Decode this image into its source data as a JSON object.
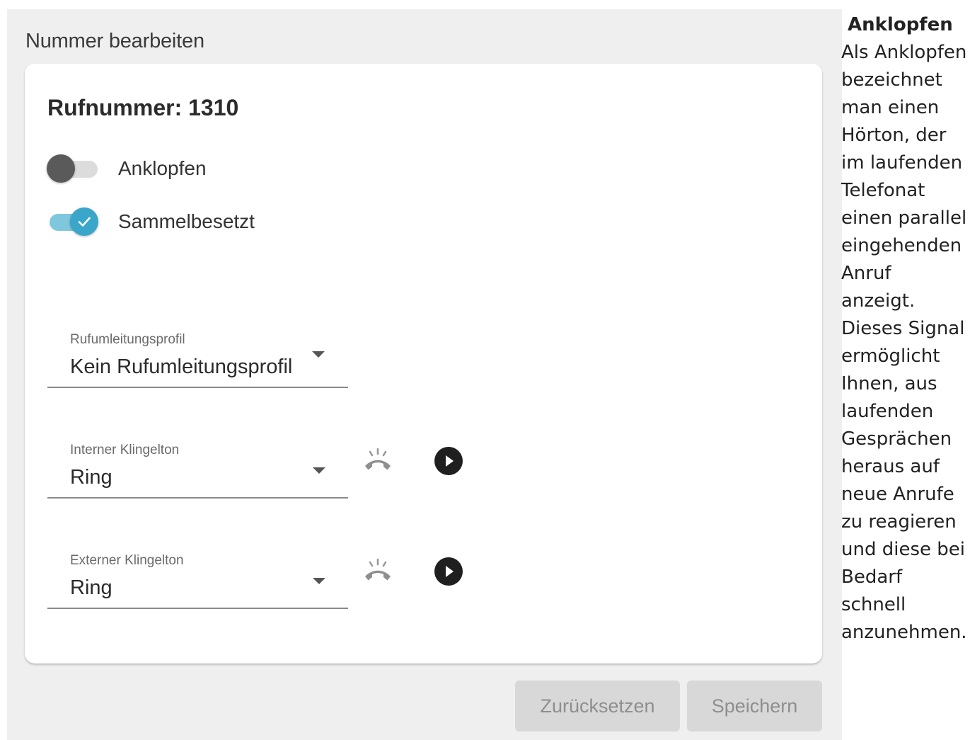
{
  "panel": {
    "title": "Nummer bearbeiten"
  },
  "card": {
    "heading": "Rufnummer: 1310",
    "toggles": [
      {
        "label": "Anklopfen",
        "state": "off"
      },
      {
        "label": "Sammelbesetzt",
        "state": "on"
      }
    ],
    "fields": {
      "redirect": {
        "label": "Rufumleitungsprofil",
        "value": "Kein Rufumleitungsprofil"
      },
      "internal": {
        "label": "Interner Klingelton",
        "value": "Ring"
      },
      "external": {
        "label": "Externer Klingelton",
        "value": "Ring"
      }
    }
  },
  "actions": {
    "reset_label": "Zurücksetzen",
    "save_label": "Speichern"
  },
  "help": {
    "title": "Anklopfen",
    "body": "Als Anklopfen\nbezeichnet\nman einen\nHörton, der\nim laufenden\nTelefonat\neinen parallel\neingehenden\nAnruf\nanzeigt.\nDieses Signal\nermöglicht\nIhnen, aus\nlaufenden\nGesprächen\nheraus auf\nneue Anrufe\nzu reagieren\nund diese bei\nBedarf\nschnell\nanzunehmen."
  },
  "colors": {
    "accent": "#3aa6c9",
    "accent_track": "#7fc7dd",
    "panel_bg": "#efefef",
    "button_bg": "#d8d8d8"
  },
  "icons": {
    "ring": "phone-ringing-icon",
    "play": "play-circle-icon",
    "check": "check-icon",
    "dropdown": "caret-down-icon"
  }
}
